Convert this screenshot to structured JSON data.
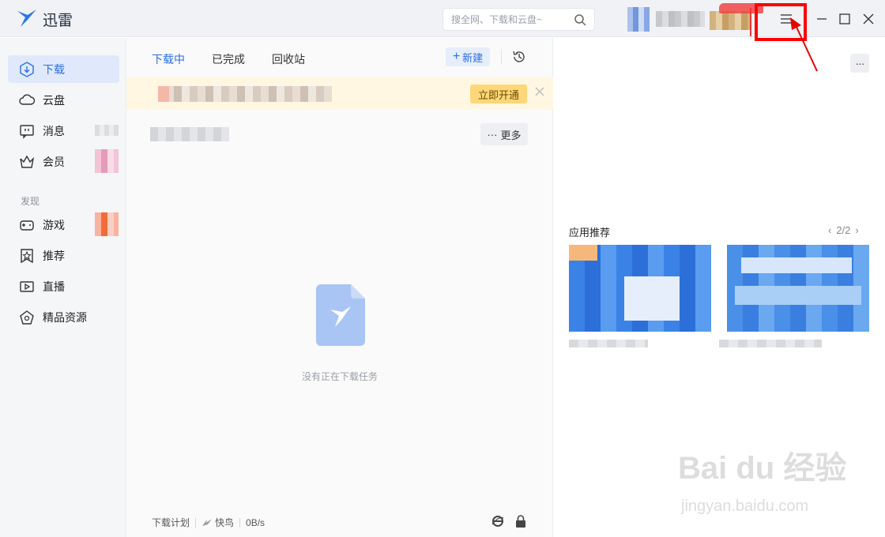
{
  "titlebar": {
    "app_title": "迅雷",
    "search_placeholder": "搜全网、下载和云盘~"
  },
  "sidebar": {
    "items": [
      {
        "label": "下载",
        "icon": "download-icon"
      },
      {
        "label": "云盘",
        "icon": "cloud-icon"
      },
      {
        "label": "消息",
        "icon": "message-icon"
      },
      {
        "label": "会员",
        "icon": "crown-icon"
      }
    ],
    "section_label": "发现",
    "discover_items": [
      {
        "label": "游戏",
        "icon": "gamepad-icon"
      },
      {
        "label": "推荐",
        "icon": "star-icon"
      },
      {
        "label": "直播",
        "icon": "live-icon"
      },
      {
        "label": "精品资源",
        "icon": "gem-icon"
      }
    ]
  },
  "center": {
    "tabs": [
      "下载中",
      "已完成",
      "回收站"
    ],
    "new_button": "新建",
    "promo_button": "立即开通",
    "more_button": "更多",
    "empty_text": "没有正在下载任务",
    "status": {
      "plan": "下载计划",
      "mode": "快鸟",
      "speed": "0B/s"
    }
  },
  "right": {
    "recommend_title": "应用推荐",
    "pager": "2/2"
  },
  "watermark": {
    "brand": "Bai du 经验",
    "url": "jingyan.baidu.com"
  },
  "colors": {
    "accent": "#2a6fe3",
    "annotation": "#ff0000",
    "promo_bg": "#fff7e1"
  }
}
